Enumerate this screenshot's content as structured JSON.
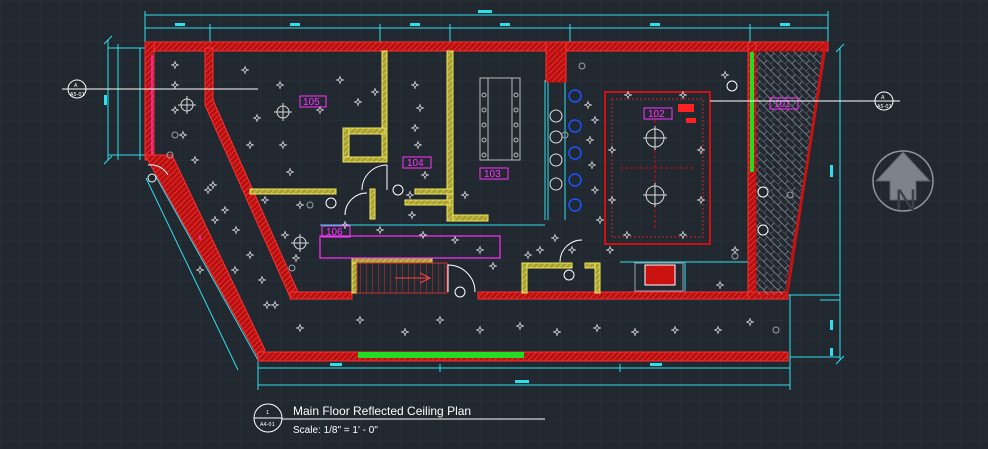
{
  "drawing": {
    "title": "Main Floor Reflected Ceiling Plan",
    "scale": "Scale: 1/8\" = 1' - 0\"",
    "title_marker": {
      "number": "1",
      "sheet": "A4-01"
    },
    "section_marker": {
      "number": "A",
      "sheet": "A5-01"
    },
    "north_label": "N"
  },
  "rooms": [
    "105",
    "104",
    "103",
    "102",
    "106",
    "101"
  ],
  "colors": {
    "background": "#212830",
    "grid": "#2b333d",
    "wall": "#cc1111",
    "wall_hatch": "#ff4444",
    "partition": "#d8d040",
    "dimension": "#2ee0ee",
    "room_tag": "#ff33ff",
    "glass": "#22dd22",
    "title_text": "#ffffff"
  }
}
